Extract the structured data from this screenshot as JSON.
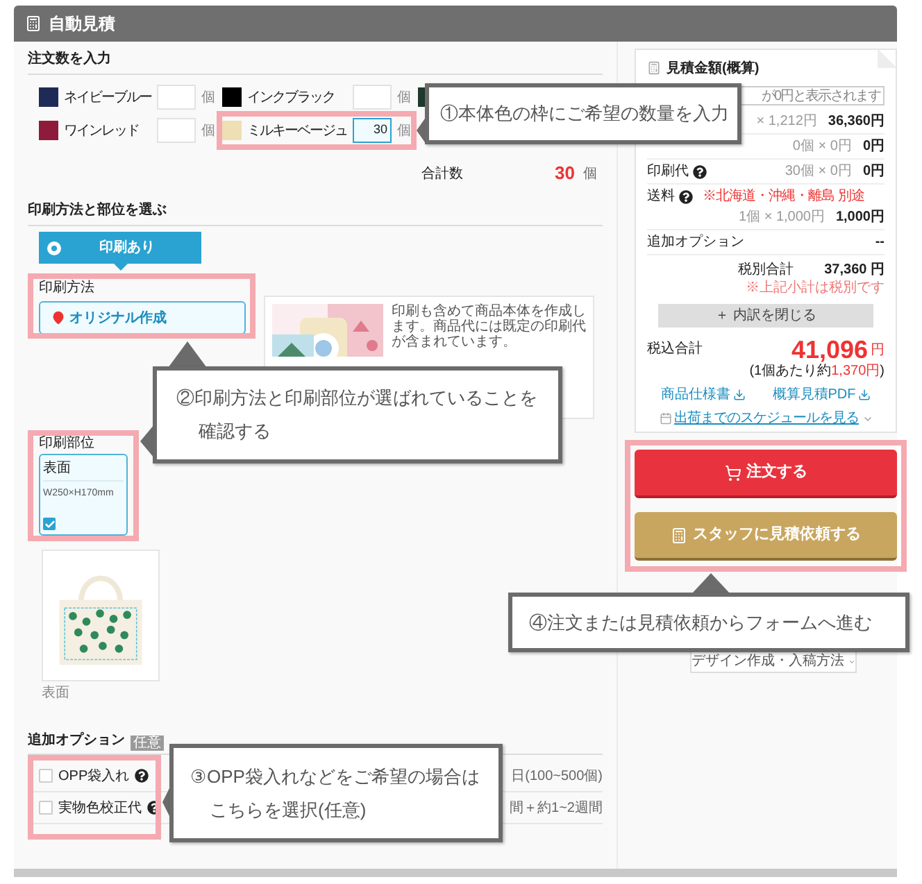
{
  "header": {
    "title": "自動見積"
  },
  "order": {
    "title": "注文数を入力",
    "colors": [
      {
        "name": "ネイビーブルー",
        "color": "#1f2b57",
        "unit": "個",
        "focused": false
      },
      {
        "name": "インクブラック",
        "color": "#000000",
        "unit": "個",
        "focused": false
      },
      {
        "color": "#1d3a2c"
      },
      {
        "name": "ワインレッド",
        "color": "#8e1b3c",
        "unit": "個",
        "focused": false
      },
      {
        "name": "ミルキーベージュ",
        "color": "#eedfb4",
        "value": "30",
        "unit": "個",
        "focused": true
      }
    ],
    "total_label": "合計数",
    "total": "30",
    "total_unit": "個"
  },
  "print": {
    "title": "印刷方法と部位を選ぶ",
    "tab": {
      "label": "印刷あり",
      "selected": true
    },
    "method_label": "印刷方法",
    "method": "オリジナル作成",
    "description": "印刷も含めて商品本体を作成します。商品代には既定の印刷代が含まれています。",
    "position_label": "印刷部位",
    "position": {
      "name": "表面",
      "size": "W250×H170mm",
      "checked": true
    },
    "preview_caption": "表面"
  },
  "options": {
    "title": "追加オプション",
    "badge": "任意",
    "items": [
      {
        "label": "OPP袋入れ",
        "checked": false,
        "note": "日(100~500個)"
      },
      {
        "label": "実物色校正代",
        "checked": false,
        "note": "間＋約1~2週間"
      }
    ]
  },
  "estimate": {
    "title": "見積金額(概算)",
    "notice": "が0円と表示されます",
    "rows": [
      {
        "kind": "plain",
        "calc": "× 1,212円",
        "amount": "36,360円"
      },
      {
        "kind": "plain",
        "calc": "0個 × 0円",
        "amount": "0円"
      },
      {
        "kind": "help",
        "label": "印刷代",
        "calc": "30個 × 0円",
        "amount": "0円"
      },
      {
        "kind": "help",
        "label": "送料",
        "remark": "※北海道・沖縄・離島 別途",
        "calc": "1個 × 1,000円",
        "amount": "1,000円"
      },
      {
        "kind": "plain",
        "label": "追加オプション",
        "amount": "--"
      }
    ],
    "subtotal_label": "税別合計",
    "subtotal": "37,360 円",
    "subtotal_note": "※上記小計は税別です",
    "toggle": "＋ 内訳を閉じる",
    "total_label": "税込合計",
    "total": "41,096",
    "total_unit": "円",
    "per_unit_before": "(1個あたり約",
    "per_unit_value": "1,370円",
    "per_unit_after": ")",
    "links": [
      {
        "label": "商品仕様書"
      },
      {
        "label": "概算見積PDF"
      }
    ],
    "schedule": "出荷までのスケジュールを見る"
  },
  "actions": [
    {
      "kind": "order",
      "label": "注文する"
    },
    {
      "kind": "request",
      "label": "スタッフに見積依頼する"
    }
  ],
  "design_link": "デザイン作成・入稿方法",
  "callouts": [
    {
      "text": "①本体色の枠にご希望の数量を入力"
    },
    {
      "text": "②印刷方法と印刷部位が選ばれていることを確認する"
    },
    {
      "text": "③OPP袋入れなどをご希望の場合はこちらを選択(任意)"
    },
    {
      "text": "④注文または見積依頼からフォームへ進む"
    }
  ]
}
